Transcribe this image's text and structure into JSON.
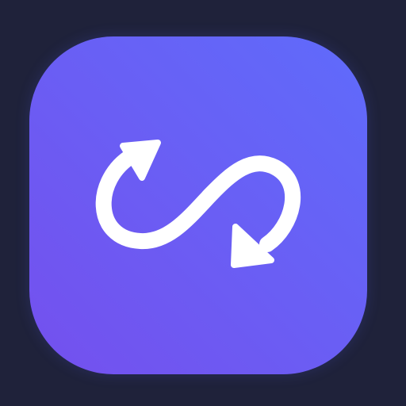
{
  "icon": {
    "name": "sync-swap-arrows-icon",
    "colors": {
      "background": "#1f223a",
      "gradient_start": "#5f6bfb",
      "gradient_mid": "#6a5ef4",
      "gradient_end": "#7450ee",
      "glyph": "#ffffff"
    }
  }
}
